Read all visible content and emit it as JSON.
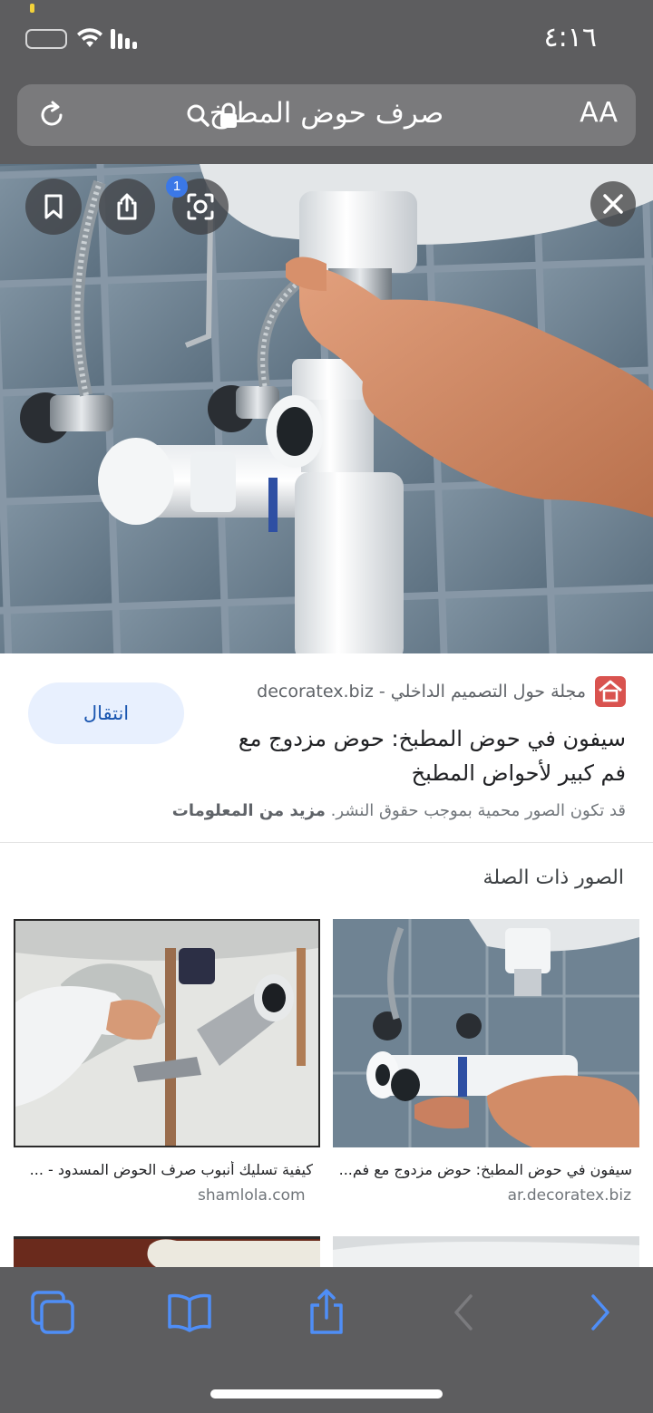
{
  "status_bar": {
    "time": "٤:١٦"
  },
  "address_bar": {
    "text_size_label": "AA",
    "query": "صرف حوض المطبخ"
  },
  "lens_badge": "1",
  "result": {
    "source": "مجلة حول التصميم الداخلي - decoratex.biz",
    "title": "سيفون في حوض المطبخ: حوض مزدوج مع فم كبير لأحواض المطبخ",
    "visit_label": "انتقال",
    "copyright_note": "قد تكون الصور محمية بموجب حقوق النشر.",
    "more_info_label": "مزيد من المعلومات"
  },
  "related": {
    "heading": "الصور ذات الصلة",
    "items": [
      {
        "caption": "سيفون في حوض المطبخ: حوض مزدوج مع فم...",
        "source": "ar.decoratex.biz"
      },
      {
        "caption": "كيفية تسليك أنبوب صرف الحوض المسدود - ...",
        "source": "shamlola.com"
      }
    ]
  },
  "colors": {
    "chrome": "#5d5d5f",
    "accent": "#3b78e7",
    "visit_bg": "#e8f0fe",
    "toolbar_icon": "#4f8ef7"
  },
  "icons": [
    "battery-icon",
    "wifi-icon",
    "signal-icon",
    "reload-icon",
    "search-icon",
    "lock-icon",
    "bookmark-icon",
    "share-icon",
    "lens-icon",
    "close-icon",
    "tabs-icon",
    "bookmarks-book-icon",
    "share-toolbar-icon",
    "back-icon",
    "forward-icon"
  ]
}
